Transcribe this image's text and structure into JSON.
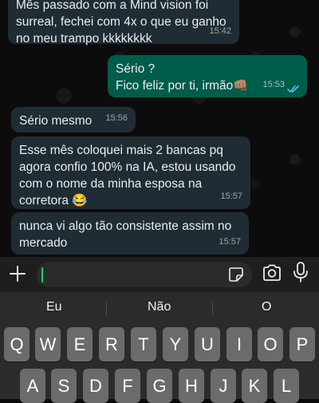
{
  "messages": [
    {
      "lines": [
        "Mês passado com a Mind vision foi",
        "surreal, fechei com 4x o que eu ganho",
        "no meu trampo kkkkkkkk"
      ],
      "time": "15:42",
      "direction": "incoming"
    },
    {
      "lines": [
        "Sério ?",
        "Fico feliz por ti, irmão👊🏽"
      ],
      "time": "15:53",
      "direction": "outgoing",
      "status": "read"
    },
    {
      "lines": [
        "Sério mesmo"
      ],
      "time": "15:56",
      "direction": "incoming"
    },
    {
      "lines": [
        "Esse mês coloquei mais 2 bancas pq",
        "agora confio 100% na IA, estou usando",
        "com o nome da minha esposa na",
        "corretora 😂"
      ],
      "time": "15:57",
      "direction": "incoming"
    },
    {
      "lines": [
        "nunca vi algo tão consistente assim no",
        "mercado"
      ],
      "time": "15:57",
      "direction": "incoming"
    }
  ],
  "input": {
    "value": "",
    "icons": [
      "plus-icon",
      "sticker-icon",
      "camera-icon",
      "mic-icon"
    ]
  },
  "keyboard": {
    "suggestions": [
      "Eu",
      "Não",
      "O"
    ],
    "row1": [
      "Q",
      "W",
      "E",
      "R",
      "T",
      "Y",
      "U",
      "I",
      "O",
      "P"
    ],
    "row2": [
      "A",
      "S",
      "D",
      "F",
      "G",
      "H",
      "J",
      "K",
      "L"
    ]
  },
  "colors": {
    "incoming_bubble": "#202c33",
    "outgoing_bubble": "#005c4b",
    "read_ticks": "#53bdeb",
    "accent": "#25d366"
  }
}
